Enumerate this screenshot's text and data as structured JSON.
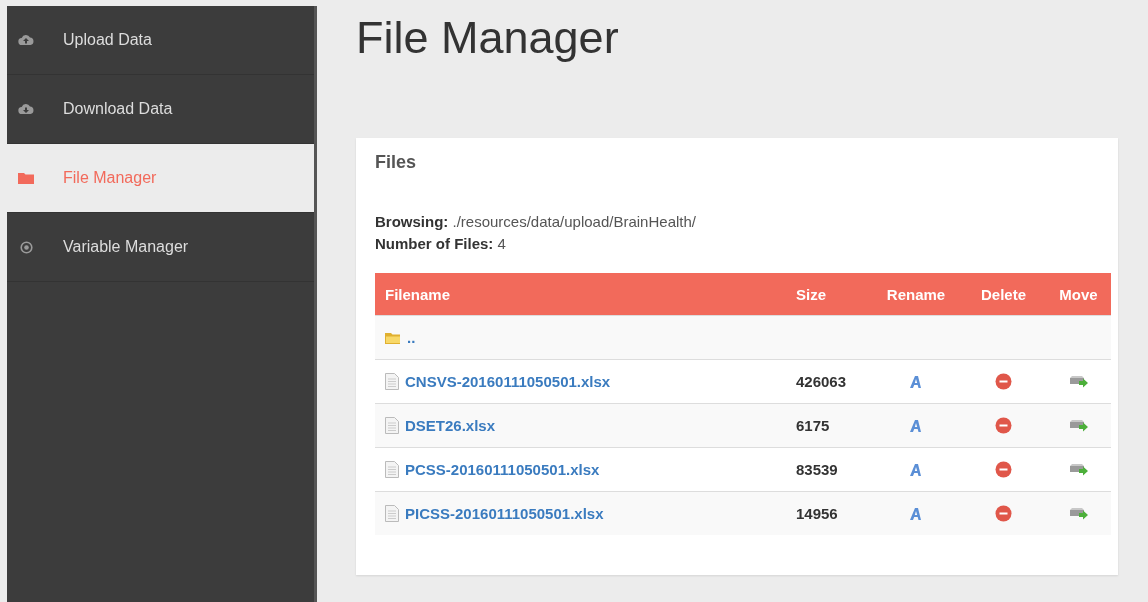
{
  "sidebar": {
    "items": [
      {
        "label": "Upload Data",
        "selected": false
      },
      {
        "label": "Download Data",
        "selected": false
      },
      {
        "label": "File Manager",
        "selected": true
      },
      {
        "label": "Variable Manager",
        "selected": false
      }
    ]
  },
  "page_title": "File Manager",
  "panel": {
    "title": "Files",
    "info": [
      "**Browsing:** ./resources/data/upload/BrainHealth/",
      "**Number of Files:** 4"
    ],
    "table": {
      "columns": [
        "Filename",
        "Size",
        "Rename",
        "Delete",
        "Move"
      ],
      "rows": [
        {
          "kind": "parent",
          "name": ".."
        },
        {
          "kind": "file",
          "name": "CNSVS-20160111050501.xlsx",
          "size": "426063"
        },
        {
          "kind": "file",
          "name": "DSET26.xlsx",
          "size": "6175"
        },
        {
          "kind": "file",
          "name": "PCSS-20160111050501.xlsx",
          "size": "83539"
        },
        {
          "kind": "file",
          "name": "PICSS-20160111050501.xlsx",
          "size": "14956"
        }
      ]
    }
  }
}
